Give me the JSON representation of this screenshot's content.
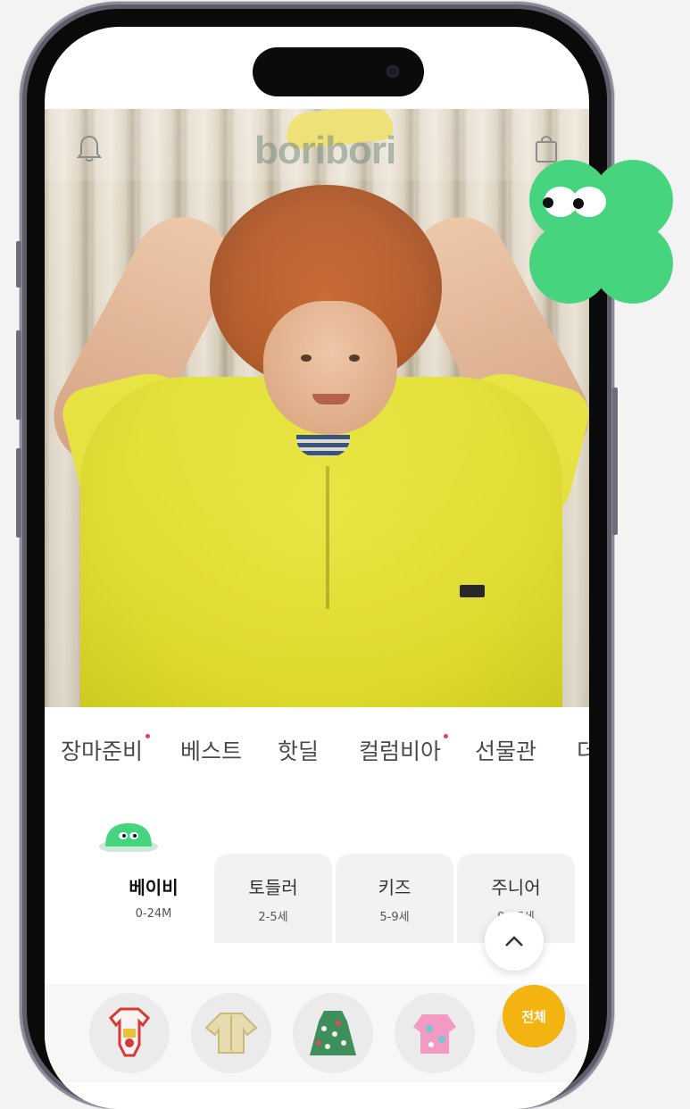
{
  "app": {
    "logo_text": "boribori",
    "accent": "#46d47e",
    "badge_color": "#ef3a62",
    "all_button_color": "#f3b411"
  },
  "header": {
    "left_icon": "bell-icon",
    "right_icon": "shopping-bag-icon"
  },
  "menu": {
    "items": [
      {
        "label": "장마준비",
        "has_dot": true
      },
      {
        "label": "베스트",
        "has_dot": false
      },
      {
        "label": "핫딜",
        "has_dot": false
      },
      {
        "label": "컬럼비아",
        "has_dot": true
      },
      {
        "label": "선물관",
        "has_dot": false
      },
      {
        "label": "더",
        "has_dot": false
      }
    ]
  },
  "age_tabs": [
    {
      "label": "베이비",
      "range": "0-24M",
      "active": true
    },
    {
      "label": "토들러",
      "range": "2-5세",
      "active": false
    },
    {
      "label": "키즈",
      "range": "5-9세",
      "active": false
    },
    {
      "label": "주니어",
      "range": "9-17세",
      "active": false
    }
  ],
  "categories": [
    {
      "icon": "baby-bodysuit-icon"
    },
    {
      "icon": "baby-top-icon"
    },
    {
      "icon": "baby-dress-icon"
    },
    {
      "icon": "pink-outfit-icon"
    },
    {
      "icon": "more-category-icon"
    }
  ],
  "buttons": {
    "scroll_top_icon": "chevron-up-icon",
    "all_label": "전체"
  }
}
